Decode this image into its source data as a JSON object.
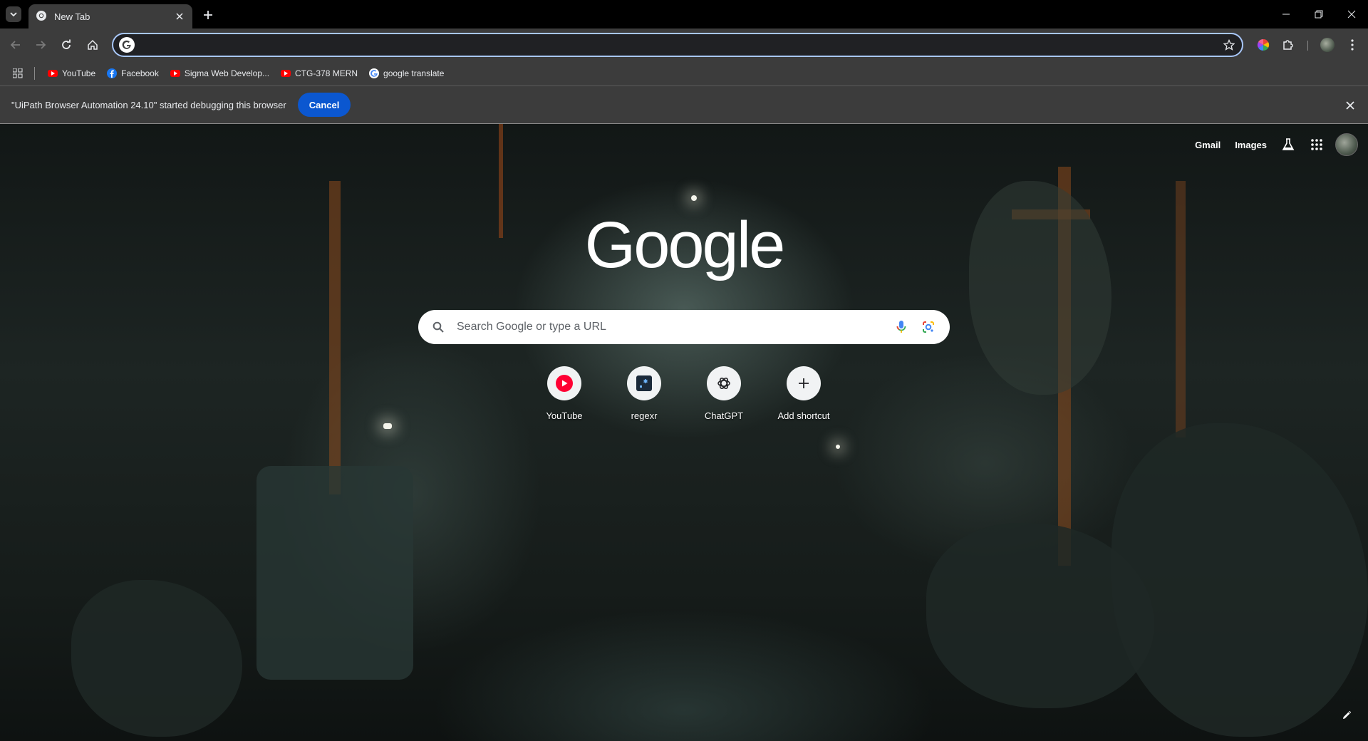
{
  "tabstrip": {
    "tab_title": "New Tab"
  },
  "toolbar": {
    "omnibox_value": ""
  },
  "bookmarks": [
    {
      "label": "YouTube",
      "icon": "youtube-icon"
    },
    {
      "label": "Facebook",
      "icon": "facebook-icon"
    },
    {
      "label": "Sigma Web Develop...",
      "icon": "youtube-icon"
    },
    {
      "label": "CTG-378 MERN",
      "icon": "youtube-icon"
    },
    {
      "label": "google translate",
      "icon": "google-icon"
    }
  ],
  "infobar": {
    "message": "\"UiPath Browser Automation 24.10\" started debugging this browser",
    "cancel_label": "Cancel"
  },
  "ntp": {
    "links": {
      "gmail": "Gmail",
      "images": "Images"
    },
    "logo": "Google",
    "search_placeholder": "Search Google or type a URL",
    "shortcuts": [
      {
        "label": "YouTube",
        "icon": "youtube-icon"
      },
      {
        "label": "regexr",
        "icon": "regexr-icon"
      },
      {
        "label": "ChatGPT",
        "icon": "chatgpt-icon"
      },
      {
        "label": "Add shortcut",
        "icon": "plus-icon"
      }
    ]
  },
  "colors": {
    "accent": "#0b57d0",
    "omnibox_focus": "#a8c7fa",
    "chrome_bg": "#3c3c3c"
  }
}
